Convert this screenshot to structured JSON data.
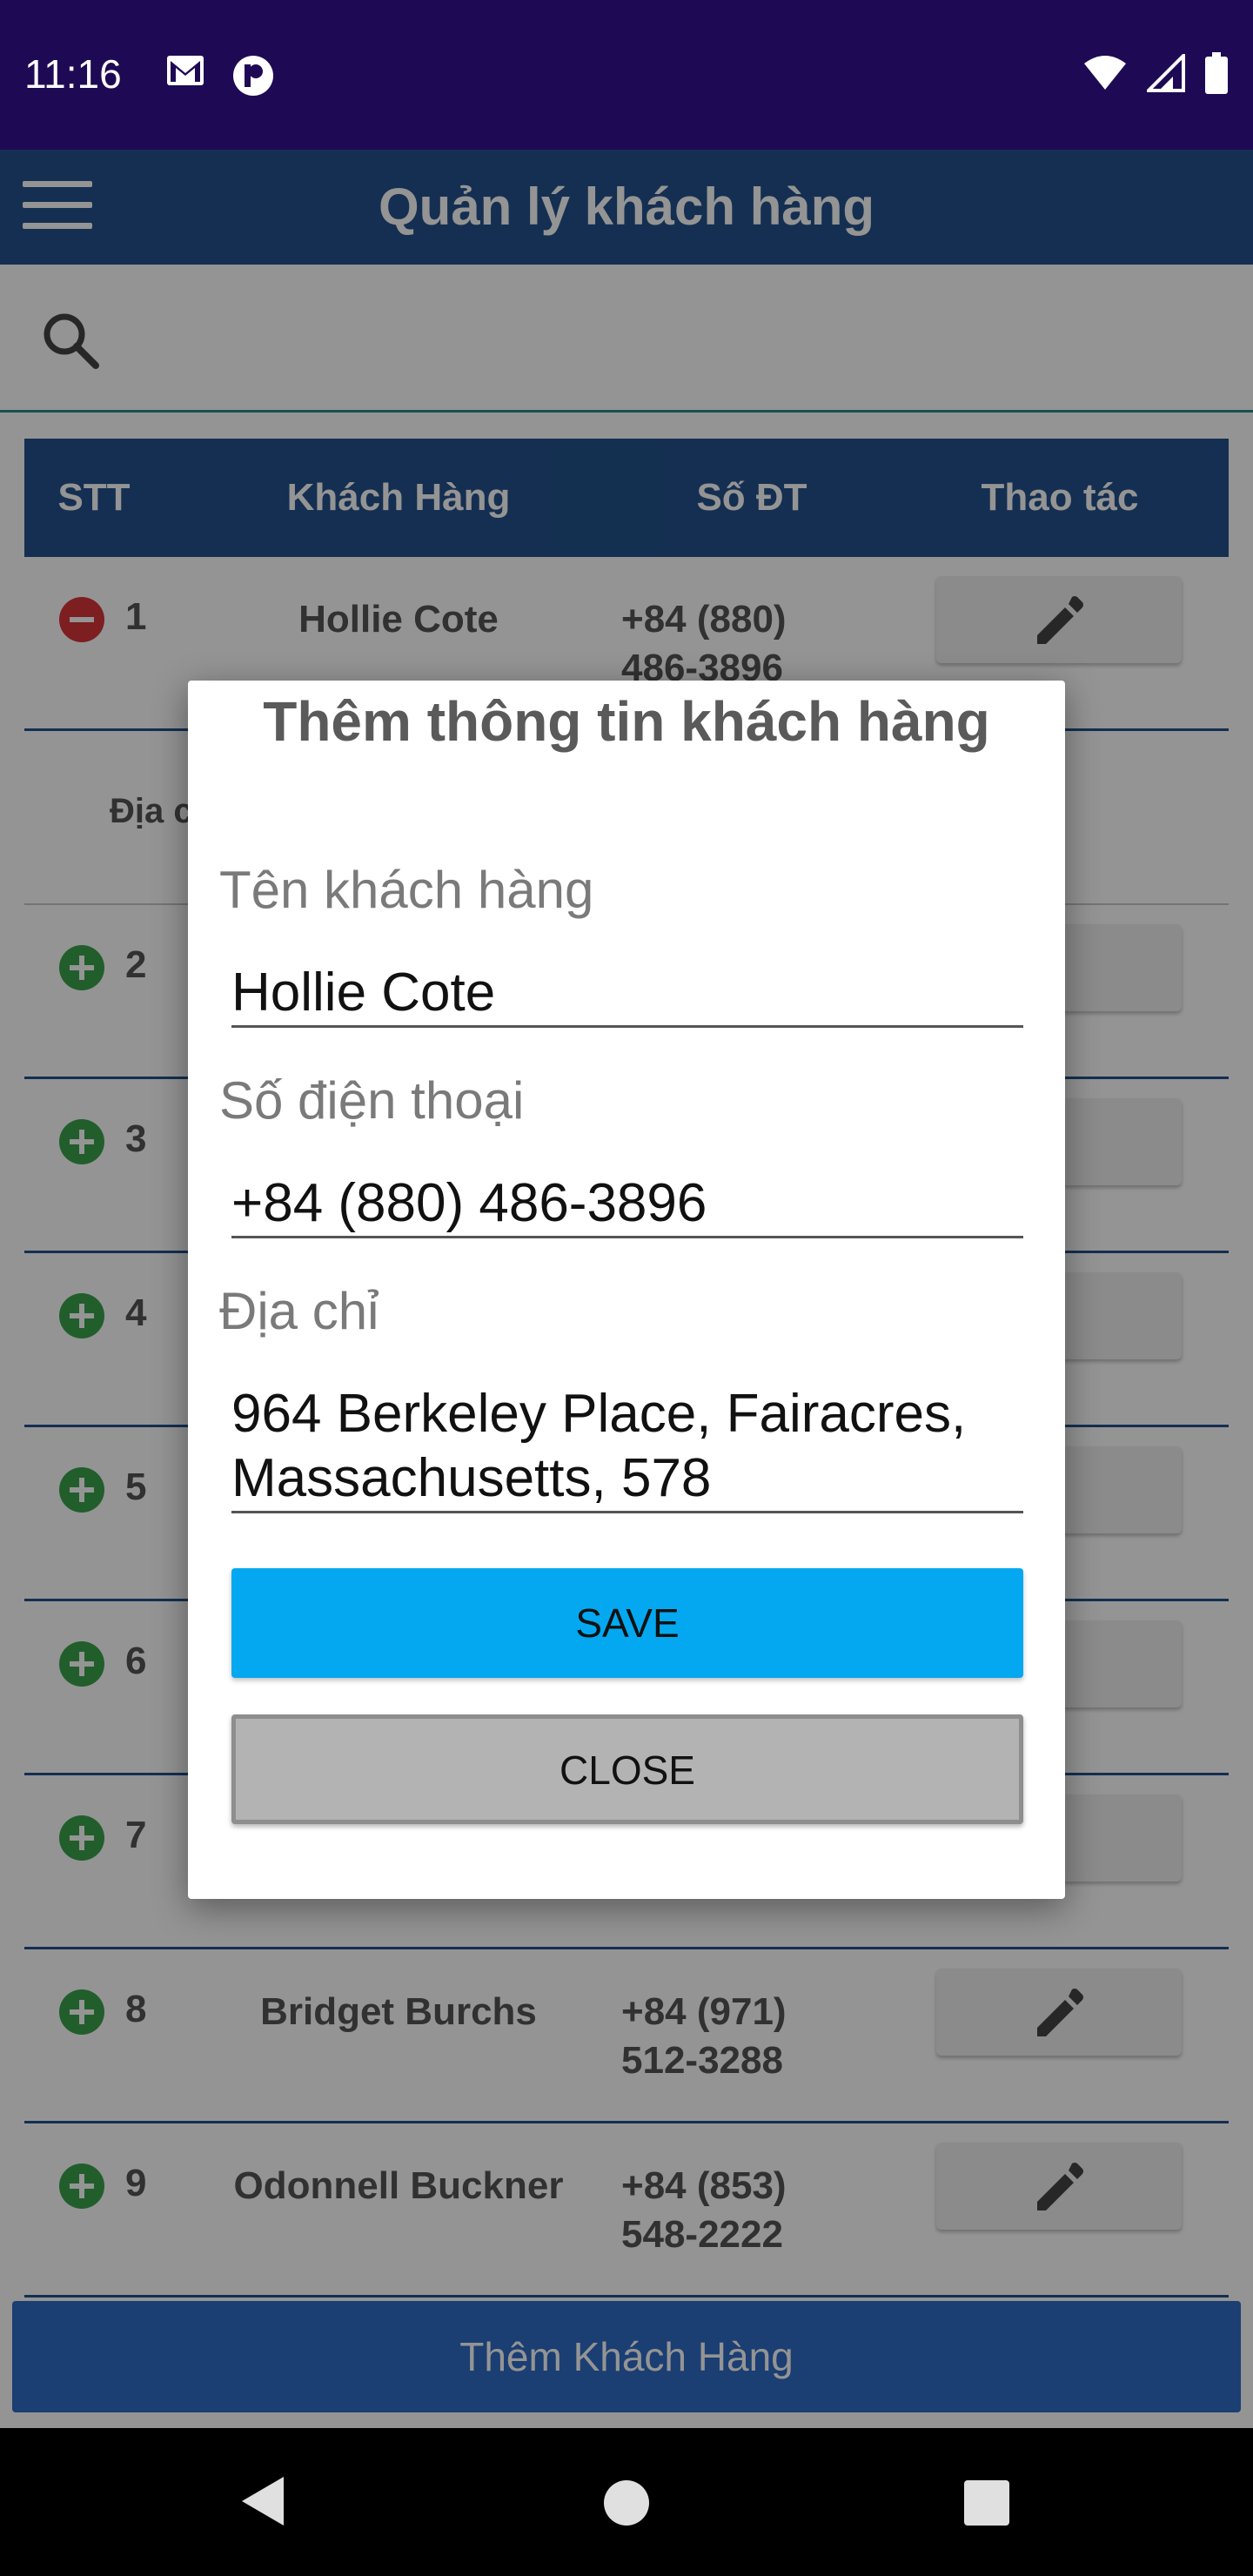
{
  "status_bar": {
    "time": "11:16",
    "icons_left": [
      "gmail-icon",
      "p-icon"
    ],
    "icons_right": [
      "wifi-icon",
      "signal-icon",
      "battery-icon"
    ]
  },
  "app_bar": {
    "title": "Quản lý khách hàng"
  },
  "table": {
    "headers": [
      "STT",
      "Khách Hàng",
      "Số ĐT",
      "Thao tác"
    ],
    "rows": [
      {
        "stt": "1",
        "name": "Hollie Cote",
        "phone": "+84 (880) 486-3896",
        "expanded": true
      },
      {
        "detail_label": "Địa c"
      },
      {
        "stt": "2",
        "name": "",
        "phone": ""
      },
      {
        "stt": "3",
        "name": "",
        "phone": ""
      },
      {
        "stt": "4",
        "name": "",
        "phone": ""
      },
      {
        "stt": "5",
        "name": "",
        "phone": ""
      },
      {
        "stt": "6",
        "name": "",
        "phone": ""
      },
      {
        "stt": "7",
        "name": "",
        "phone": ""
      },
      {
        "stt": "8",
        "name": "Bridget Burchs",
        "phone": "+84 (971) 512-3288"
      },
      {
        "stt": "9",
        "name": "Odonnell Buckner",
        "phone": "+84 (853) 548-2222"
      }
    ]
  },
  "add_button": {
    "label": "Thêm Khách Hàng"
  },
  "dialog": {
    "title": "Thêm thông tin khách hàng",
    "name_label": "Tên khách hàng",
    "name_value": "Hollie Cote",
    "phone_label": "Số điện thoại",
    "phone_value": "+84 (880) 486-3896",
    "address_label": "Địa chỉ",
    "address_value_line1": "964 Berkeley Place, Fairacres,",
    "address_value_line2": "Massachusetts, 578",
    "save_label": "SAVE",
    "close_label": "CLOSE"
  },
  "colors": {
    "primary": "#23528c",
    "accent": "#03a8f0",
    "status_bar": "#1e0a54"
  }
}
